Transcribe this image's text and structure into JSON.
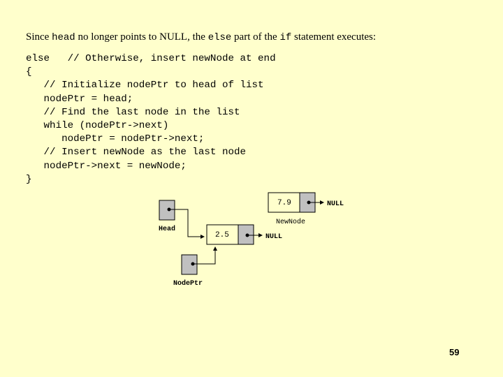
{
  "slide": {
    "intro": {
      "part1": "Since ",
      "code1": "head",
      "part2": " no longer points to ",
      "null_word": "NULL",
      "part3": ", the ",
      "code2": "else",
      "part4": " part of the ",
      "code3": "if",
      "part5": " statement executes:"
    },
    "code_lines": [
      "else   // Otherwise, insert newNode at end",
      "{",
      "   // Initialize nodePtr to head of list",
      "   nodePtr = head;",
      "   // Find the last node in the list",
      "   while (nodePtr->next)",
      "      nodePtr = nodePtr->next;",
      "   // Insert newNode as the last node",
      "   nodePtr->next = newNode;",
      "}"
    ],
    "diagram": {
      "head_label": "Head",
      "nodeptr_label": "NodePtr",
      "node1_value": "2.5",
      "node1_null": "NULL",
      "newnode_value": "7.9",
      "newnode_null": "NULL",
      "newnode_label": "NewNode"
    },
    "page_number": "59",
    "colors": {
      "background": "#ffffcc",
      "pointer_cell": "#c0c0c0"
    }
  }
}
